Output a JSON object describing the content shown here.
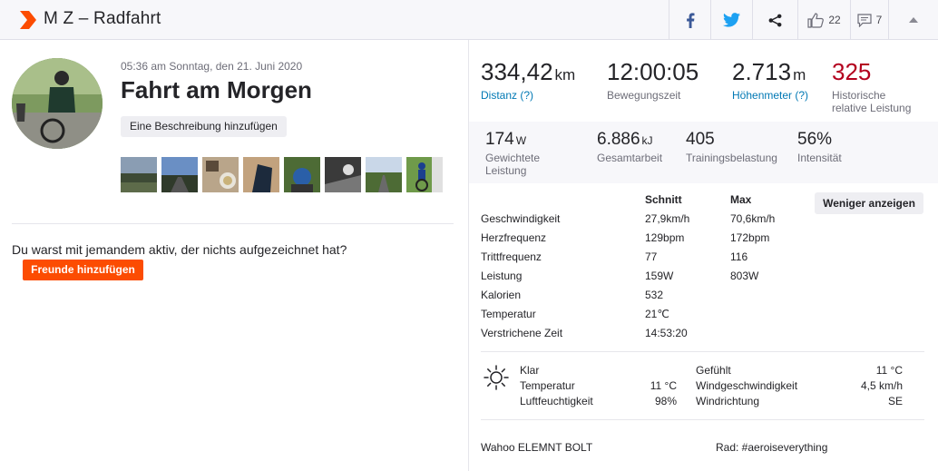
{
  "header": {
    "title": "M Z – Radfahrt",
    "kudos_count": "22",
    "comments_count": "7"
  },
  "activity": {
    "datetime": "05:36 am Sonntag, den 21. Juni 2020",
    "title": "Fahrt am Morgen",
    "add_description": "Eine Beschreibung hinzufügen",
    "with_text": "Du warst mit jemandem aktiv, der nichts aufgezeichnet hat?",
    "add_friends": "Freunde hinzufügen"
  },
  "main_stats": {
    "distance": {
      "value": "334,42",
      "unit": "km",
      "label": "Distanz (?)"
    },
    "moving_time": {
      "value": "12:00:05",
      "label": "Bewegungszeit"
    },
    "elevation": {
      "value": "2.713",
      "unit": "m",
      "label": "Höhenmeter (?)"
    },
    "relative_effort": {
      "value": "325",
      "label1": "Historische",
      "label2": "relative Leistung"
    }
  },
  "secondary_stats": {
    "weighted_power": {
      "value": "174",
      "unit": "W",
      "label1": "Gewichtete",
      "label2": "Leistung"
    },
    "total_work": {
      "value": "6.886",
      "unit": "kJ",
      "label": "Gesamtarbeit"
    },
    "training_load": {
      "value": "405",
      "label": "Trainingsbelastung"
    },
    "intensity": {
      "value": "56%",
      "label": "Intensität"
    }
  },
  "table": {
    "col_avg": "Schnitt",
    "col_max": "Max",
    "less_button": "Weniger anzeigen",
    "rows": [
      {
        "label": "Geschwindigkeit",
        "avg": "27,9km/h",
        "max": "70,6km/h"
      },
      {
        "label": "Herzfrequenz",
        "avg": "129bpm",
        "max": "172bpm"
      },
      {
        "label": "Trittfrequenz",
        "avg": "77",
        "max": "116"
      },
      {
        "label": "Leistung",
        "avg": "159W",
        "max": "803W"
      },
      {
        "label": "Kalorien",
        "avg": "532",
        "max": ""
      },
      {
        "label": "Temperatur",
        "avg": "21℃",
        "max": ""
      },
      {
        "label": "Verstrichene Zeit",
        "avg": "14:53:20",
        "max": ""
      }
    ]
  },
  "weather": {
    "condition": "Klar",
    "temp_label": "Temperatur",
    "temp_value": "11 °C",
    "humidity_label": "Luftfeuchtigkeit",
    "humidity_value": "98%",
    "feels_label": "Gefühlt",
    "feels_value": "11 °C",
    "wind_speed_label": "Windgeschwindigkeit",
    "wind_speed_value": "4,5 km/h",
    "wind_dir_label": "Windrichtung",
    "wind_dir_value": "SE"
  },
  "device": "Wahoo ELEMNT BOLT",
  "bike": "Rad: #aeroiseverything",
  "colors": {
    "accent": "#fc4c02",
    "link": "#0078b4",
    "effort": "#b3001e"
  }
}
